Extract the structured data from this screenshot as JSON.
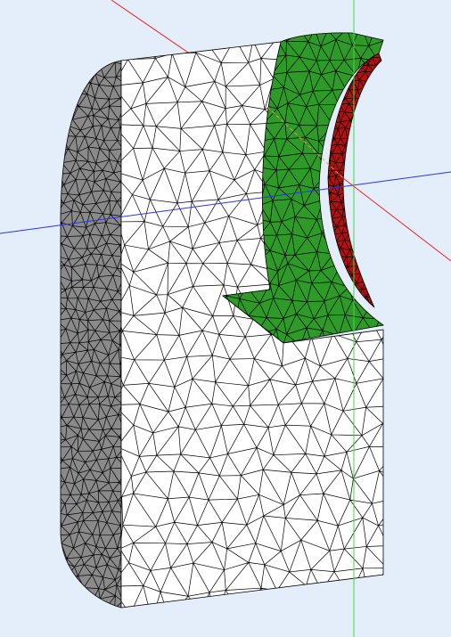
{
  "viewport": {
    "background": "#e4eefa"
  },
  "colors": {
    "mesh_line": "#000000",
    "white_face": "#ffffff",
    "gray_face": "#8a8a8a",
    "gray_face_dark": "#6f6f6f",
    "green_face": "#2e9a28",
    "green_face_dark": "#1f7a1d",
    "red_face": "#b01212",
    "red_face_dark": "#7a0b0b",
    "axis_x": "#e8262a",
    "axis_y": "#3ddc3d",
    "axis_z": "#2a34e8",
    "axis_dashed": "#e8a040"
  },
  "scene": {
    "objects": [
      "meshed-cylinder-body",
      "green-bearing-insert",
      "red-inner-surface",
      "coordinate-axes"
    ]
  }
}
